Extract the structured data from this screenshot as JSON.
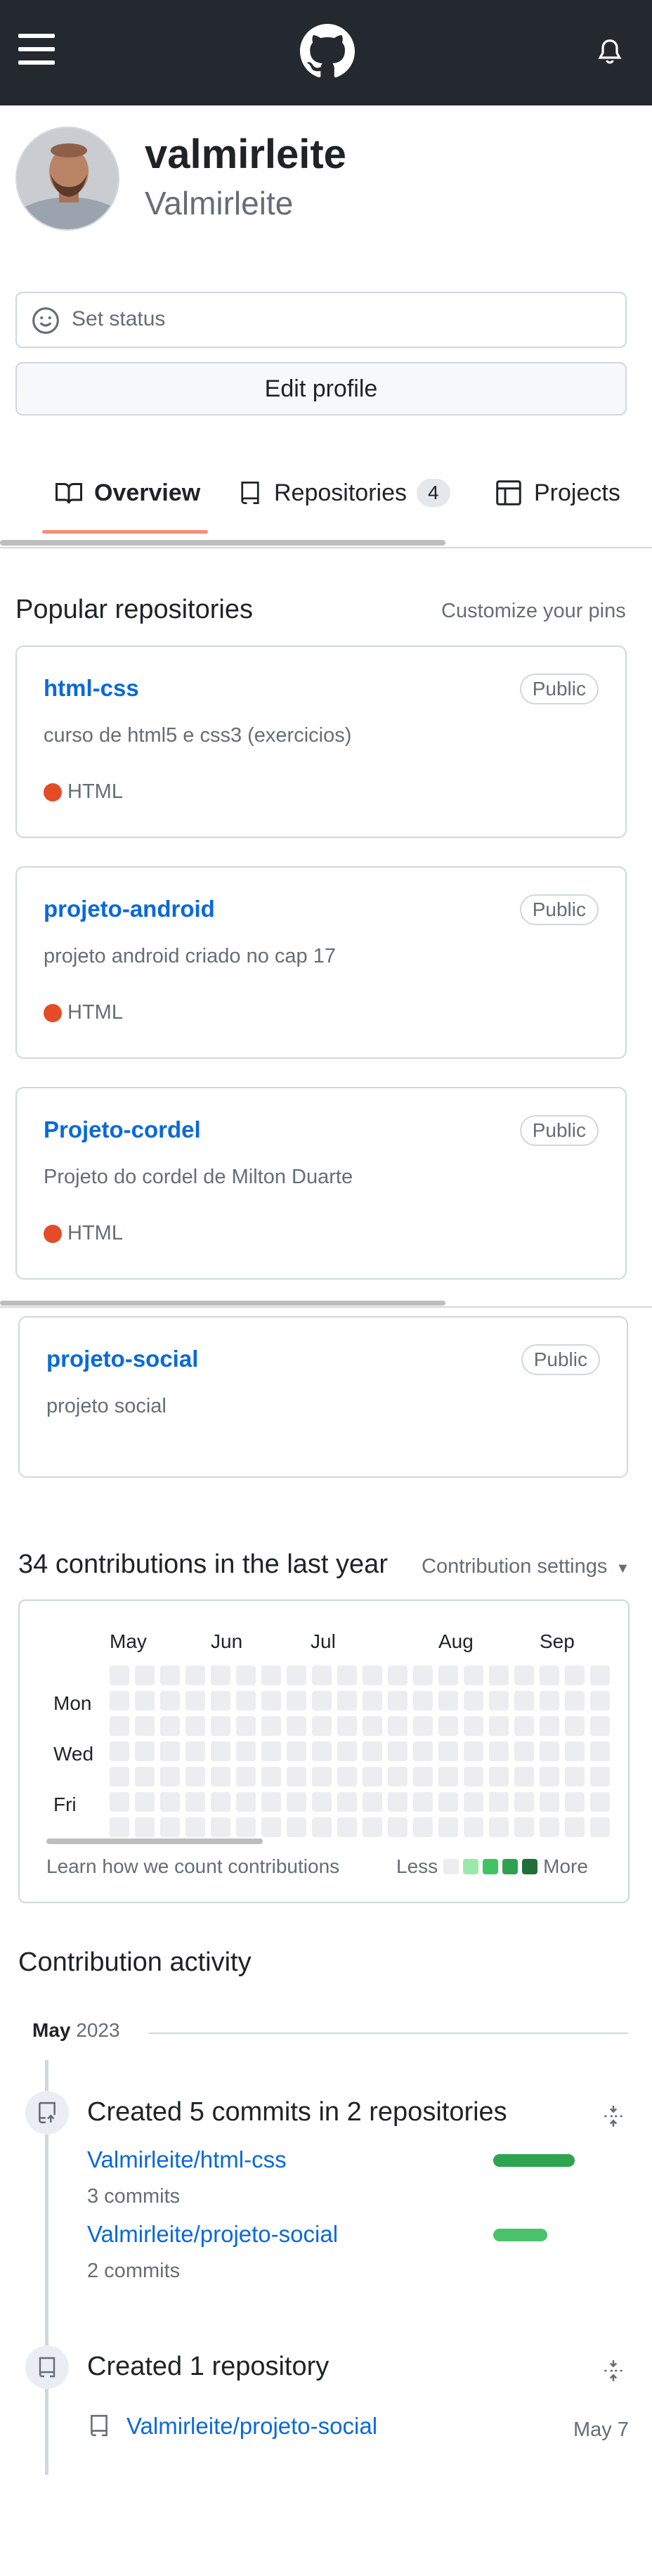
{
  "header": {
    "menu_icon": "hamburger-icon",
    "logo_icon": "github-mark-icon",
    "notifications_icon": "bell-icon"
  },
  "profile": {
    "username": "valmirleite",
    "full_name": "Valmirleite",
    "status_label": "Set status",
    "edit_button": "Edit profile"
  },
  "tabs": [
    {
      "label": "Overview",
      "icon": "book-icon",
      "active": true
    },
    {
      "label": "Repositories",
      "icon": "repo-icon",
      "count": "4"
    },
    {
      "label": "Projects",
      "icon": "table-icon"
    }
  ],
  "popular": {
    "title": "Popular repositories",
    "customize": "Customize your pins",
    "repos": [
      {
        "name": "html-css",
        "visibility": "Public",
        "description": "curso de html5 e css3 (exercicios)",
        "language": "HTML"
      },
      {
        "name": "projeto-android",
        "visibility": "Public",
        "description": "projeto android criado no cap 17",
        "language": "HTML"
      },
      {
        "name": "Projeto-cordel",
        "visibility": "Public",
        "description": "Projeto do cordel de Milton Duarte",
        "language": "HTML"
      },
      {
        "name": "projeto-social",
        "visibility": "Public",
        "description": "projeto social"
      }
    ],
    "lang_color": "#e34c26"
  },
  "contributions": {
    "title": "34 contributions in the last year",
    "settings": "Contribution settings",
    "months": [
      "May",
      "Jun",
      "Jul",
      "Aug",
      "Sep"
    ],
    "days": [
      "Mon",
      "Wed",
      "Fri"
    ],
    "learn": "Learn how we count contributions",
    "less": "Less",
    "more": "More",
    "legend_colors": [
      "#ebedf0",
      "#9be9a8",
      "#40c463",
      "#30a14e",
      "#216e39"
    ]
  },
  "activity": {
    "title": "Contribution activity",
    "month": "May",
    "year": "2023",
    "items": [
      {
        "title": "Created 5 commits in 2 repositories",
        "repos": [
          {
            "name": "Valmirleite/html-css",
            "commits": "3 commits",
            "share": 0.6
          },
          {
            "name": "Valmirleite/projeto-social",
            "commits": "2 commits",
            "share": 0.4
          }
        ]
      },
      {
        "title": "Created 1 repository",
        "repo": "Valmirleite/projeto-social",
        "date": "May 7"
      }
    ]
  }
}
